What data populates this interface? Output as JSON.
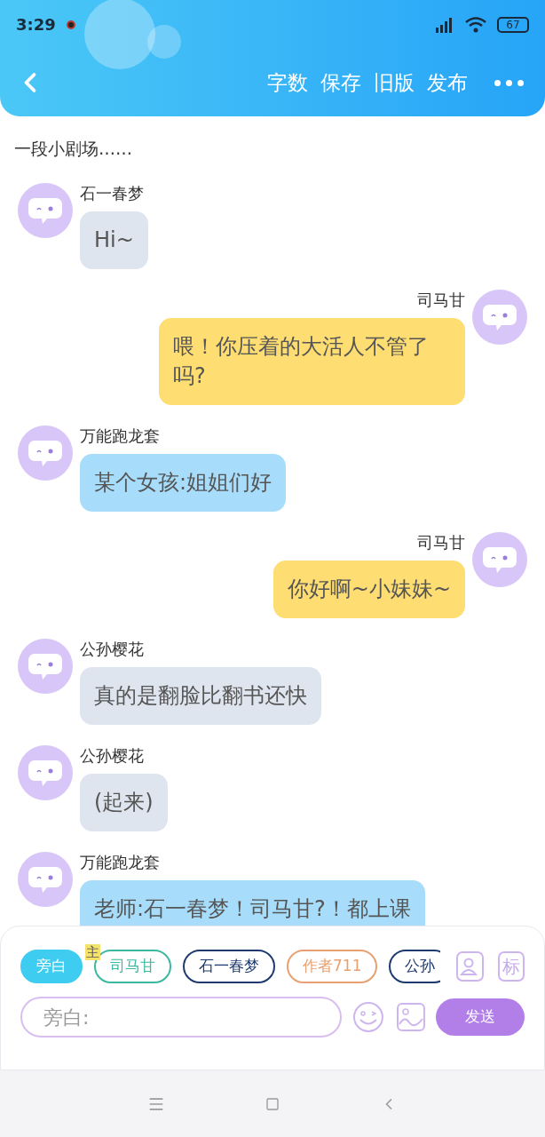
{
  "status_bar": {
    "time": "3:29",
    "battery": "67"
  },
  "header": {
    "actions": [
      "字数",
      "保存",
      "旧版",
      "发布"
    ]
  },
  "scene_title": "一段小剧场……",
  "messages": [
    {
      "kind": "left",
      "name": "石一春梦",
      "text": "Hi~",
      "color": "#dfe5ee"
    },
    {
      "kind": "right",
      "name": "司马甘",
      "text": "喂！你压着的大活人不管了吗?",
      "color": "#fedd72"
    },
    {
      "kind": "left",
      "name": "万能跑龙套",
      "text": "某个女孩:姐姐们好",
      "color": "#a7ddfa"
    },
    {
      "kind": "right",
      "name": "司马甘",
      "text": "你好啊~小妹妹~",
      "color": "#fedd72"
    },
    {
      "kind": "left",
      "name": "公孙樱花",
      "text": "真的是翻脸比翻书还快",
      "color": "#dfe5ee"
    },
    {
      "kind": "left",
      "name": "公孙樱花",
      "text": "(起来)",
      "color": "#dfe5ee"
    },
    {
      "kind": "left",
      "name": "万能跑龙套",
      "text": "老师:石一春梦！司马甘?！都上课",
      "color": "#a7ddfa"
    }
  ],
  "roles": [
    {
      "label": "旁白",
      "selected": true,
      "color": "#3ecdf0"
    },
    {
      "label": "司马甘",
      "selected": false,
      "color": "#3bb8a0",
      "badge": "主"
    },
    {
      "label": "石一春梦",
      "selected": false,
      "color": "#1e3a6e"
    },
    {
      "label": "作者711",
      "selected": false,
      "color": "#e8a070"
    },
    {
      "label": "公孙",
      "selected": false,
      "color": "#1e3a6e"
    }
  ],
  "mark_button": "标",
  "input": {
    "placeholder": "旁白:"
  },
  "send_button": "发送"
}
